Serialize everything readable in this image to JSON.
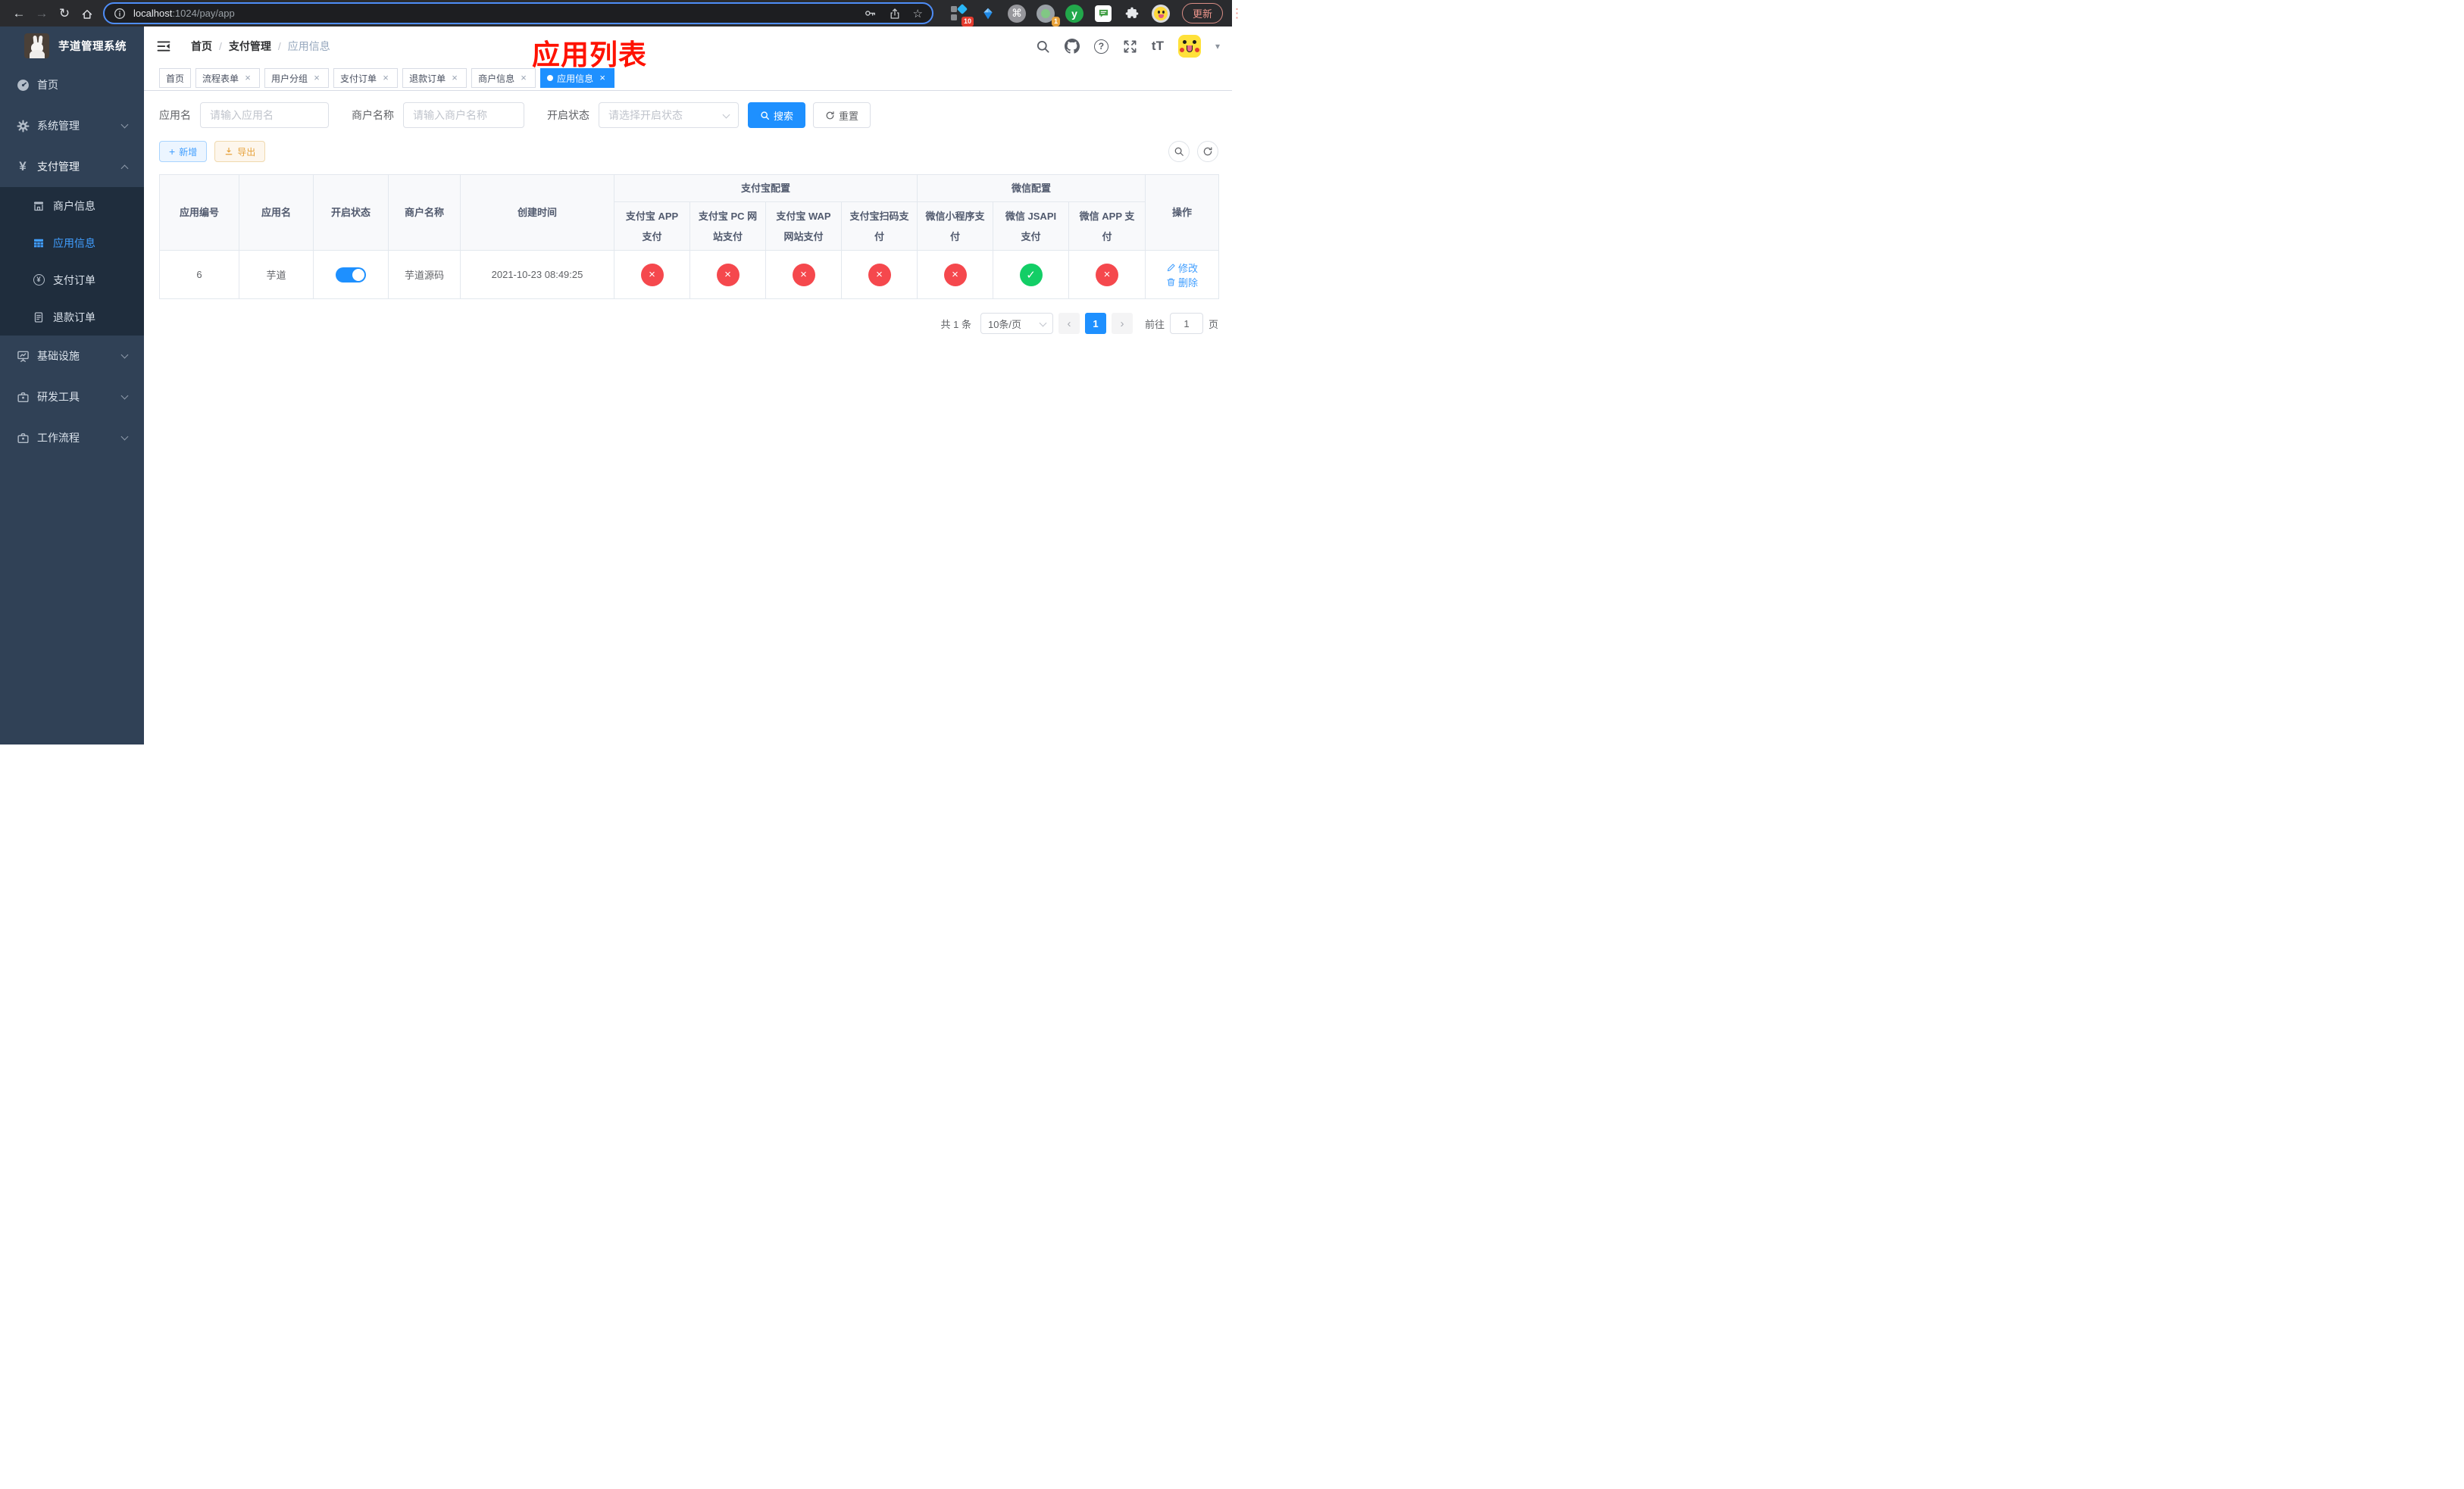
{
  "colors": {
    "primary": "#1e90ff",
    "link": "#409eff",
    "success": "#13ce66",
    "danger": "#f5484d",
    "warning": "#e6a23c",
    "annotation_red": "#ff1200",
    "sidebar_bg": "#304156",
    "submenu_bg": "#1f2d3d"
  },
  "icons": {
    "back": "←",
    "forward": "→",
    "reload": "↻",
    "star": "☆",
    "command": "⌘",
    "dots": "⋮",
    "caret": "▾",
    "slash": "/",
    "yen": "¥",
    "question": "?",
    "font_size": "tT",
    "check": "✓",
    "cross": "×",
    "close": "×",
    "plus": "+",
    "prev": "‹",
    "next": "›",
    "y_letter": "y"
  },
  "browser": {
    "url_host": "localhost",
    "url_path": ":1024/pay/app",
    "update_label": "更新",
    "grid_ext_badge": "10",
    "dot_ext_badge": "1"
  },
  "sidebar": {
    "app_title": "芋道管理系统",
    "items": [
      {
        "label": "首页"
      },
      {
        "label": "系统管理"
      },
      {
        "label": "支付管理"
      },
      {
        "label": "基础设施"
      },
      {
        "label": "研发工具"
      },
      {
        "label": "工作流程"
      }
    ],
    "payment_submenu": [
      {
        "label": "商户信息"
      },
      {
        "label": "应用信息",
        "active": true
      },
      {
        "label": "支付订单"
      },
      {
        "label": "退款订单"
      }
    ]
  },
  "navbar": {
    "breadcrumb": [
      "首页",
      "支付管理",
      "应用信息"
    ]
  },
  "annotation": {
    "title": "应用列表"
  },
  "tabs": [
    {
      "label": "首页",
      "closable": false
    },
    {
      "label": "流程表单",
      "closable": true
    },
    {
      "label": "用户分组",
      "closable": true
    },
    {
      "label": "支付订单",
      "closable": true
    },
    {
      "label": "退款订单",
      "closable": true
    },
    {
      "label": "商户信息",
      "closable": true
    },
    {
      "label": "应用信息",
      "closable": true,
      "active": true
    }
  ],
  "filters": {
    "app_name_label": "应用名",
    "app_name_placeholder": "请输入应用名",
    "merchant_label": "商户名称",
    "merchant_placeholder": "请输入商户名称",
    "status_label": "开启状态",
    "status_placeholder": "请选择开启状态",
    "search_label": "搜索",
    "reset_label": "重置"
  },
  "toolbar": {
    "add_label": "新增",
    "export_label": "导出"
  },
  "table": {
    "plain_columns": [
      "应用编号",
      "应用名",
      "开启状态",
      "商户名称",
      "创建时间"
    ],
    "alipay_group": "支付宝配置",
    "wechat_group": "微信配置",
    "alipay_columns": [
      "支付宝 APP 支付",
      "支付宝 PC 网站支付",
      "支付宝 WAP 网站支付",
      "支付宝扫码支付"
    ],
    "wechat_columns": [
      "微信小程序支付",
      "微信 JSAPI 支付",
      "微信 APP 支付"
    ],
    "actions_column": "操作",
    "rows": [
      {
        "app_id": "6",
        "app_name": "芋道",
        "enabled": true,
        "merchant_name": "芋道源码",
        "create_time": "2021-10-23 08:49:25",
        "alipay_app": false,
        "alipay_pc": false,
        "alipay_wap": false,
        "alipay_qr": false,
        "wechat_mini": false,
        "wechat_jsapi": true,
        "wechat_app": false,
        "edit_label": "修改",
        "delete_label": "删除"
      }
    ]
  },
  "pagination": {
    "total_label": "共 1 条",
    "page_size": "10条/页",
    "current_page": "1",
    "goto_label": "前往",
    "goto_value": "1",
    "goto_unit": "页"
  }
}
